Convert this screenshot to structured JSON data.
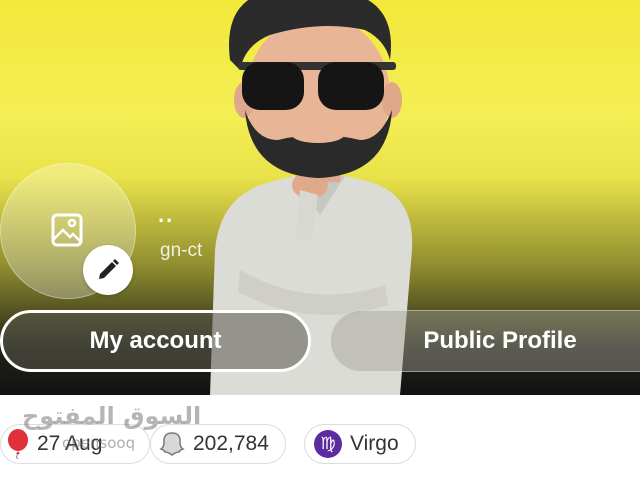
{
  "profile": {
    "display_name": "..",
    "username": "gn-ct"
  },
  "buttons": {
    "my_account": "My account",
    "public_profile": "Public Profile"
  },
  "chips": {
    "birthday": "27 Aug",
    "snap_score": "202,784",
    "zodiac": "Virgo",
    "zodiac_symbol": "♍"
  },
  "watermark": {
    "text": "السوق المفتوح",
    "sub": "opensooq"
  },
  "colors": {
    "background_top": "#f2e93a",
    "zodiac_badge": "#5a2ca0",
    "balloon": "#e0303a"
  },
  "icons": [
    "image-icon",
    "pencil-icon",
    "balloon-icon",
    "ghost-icon",
    "virgo-icon"
  ]
}
